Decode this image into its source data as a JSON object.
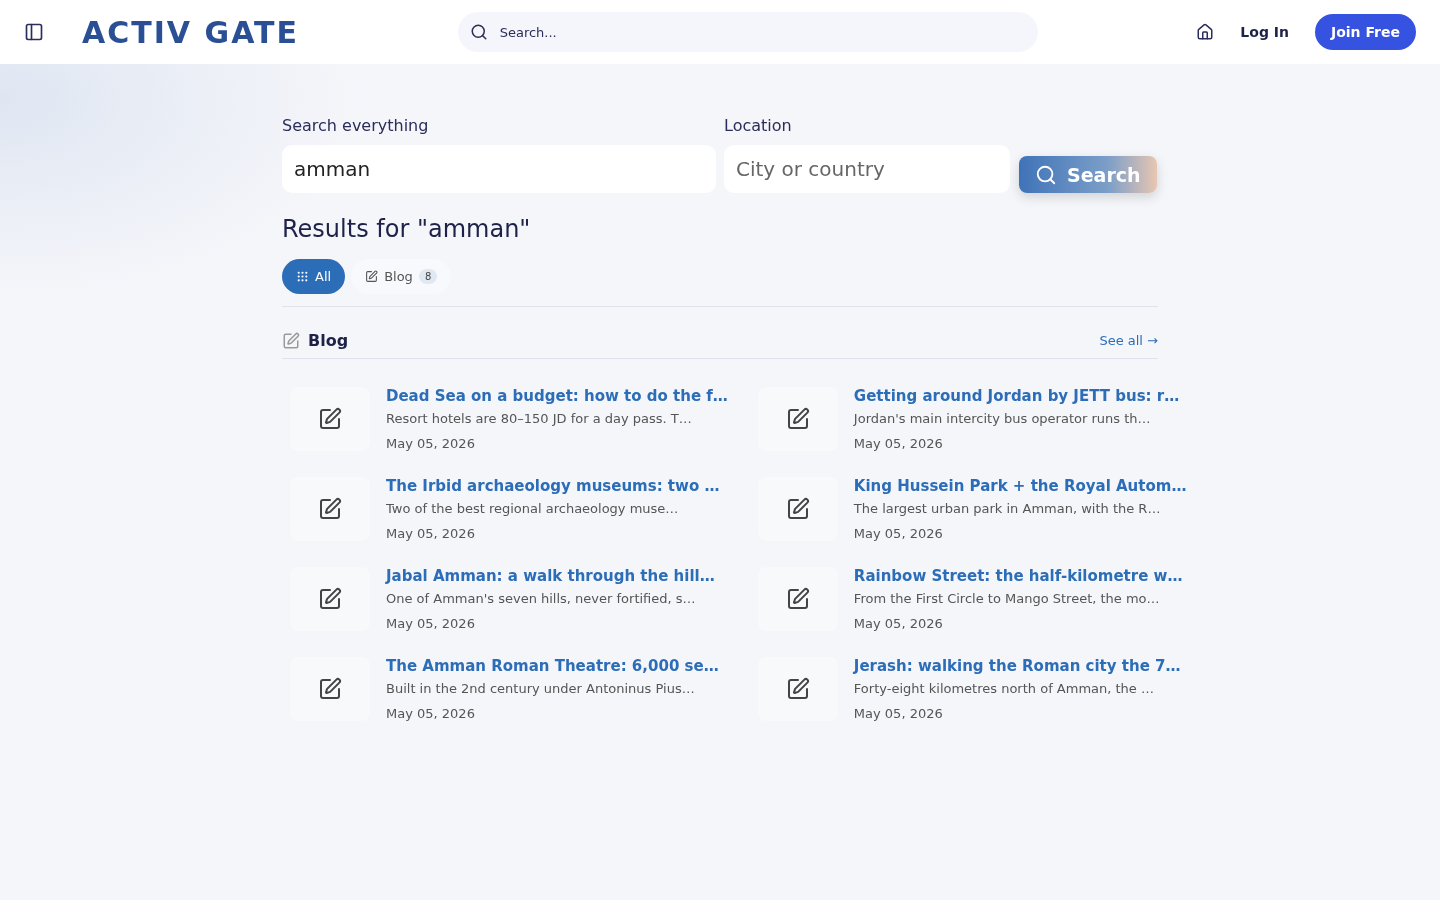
{
  "header": {
    "logo": "ACTIV GATE",
    "search_placeholder": "Search...",
    "login": "Log In",
    "join": "Join Free"
  },
  "search": {
    "query_label": "Search everything",
    "query_value": "amman",
    "location_label": "Location",
    "location_placeholder": "City or country",
    "button": "Search"
  },
  "results_title": "Results for \"amman\"",
  "filters": [
    {
      "label": "All",
      "kind": "all",
      "selected": true
    },
    {
      "label": "Blog",
      "kind": "blog",
      "count": "8",
      "selected": false
    }
  ],
  "section": {
    "title": "Blog",
    "see_all": "See all →"
  },
  "posts": [
    {
      "title": "Dead Sea on a budget: how to do the f…",
      "excerpt": "Resort hotels are 80–150 JD for a day pass. T…",
      "date": "May 05, 2026"
    },
    {
      "title": "Getting around Jordan by JETT bus: r…",
      "excerpt": "Jordan's main intercity bus operator runs th…",
      "date": "May 05, 2026"
    },
    {
      "title": "The Irbid archaeology museums: two …",
      "excerpt": "Two of the best regional archaeology muse…",
      "date": "May 05, 2026"
    },
    {
      "title": "King Hussein Park + the Royal Autom…",
      "excerpt": "The largest urban park in Amman, with the R…",
      "date": "May 05, 2026"
    },
    {
      "title": "Jabal Amman: a walk through the hill…",
      "excerpt": "One of Amman's seven hills, never fortified, s…",
      "date": "May 05, 2026"
    },
    {
      "title": "Rainbow Street: the half-kilometre w…",
      "excerpt": "From the First Circle to Mango Street, the mo…",
      "date": "May 05, 2026"
    },
    {
      "title": "The Amman Roman Theatre: 6,000 se…",
      "excerpt": "Built in the 2nd century under Antoninus Pius…",
      "date": "May 05, 2026"
    },
    {
      "title": "Jerash: walking the Roman city the 7…",
      "excerpt": "Forty-eight kilometres north of Amman, the …",
      "date": "May 05, 2026"
    }
  ]
}
